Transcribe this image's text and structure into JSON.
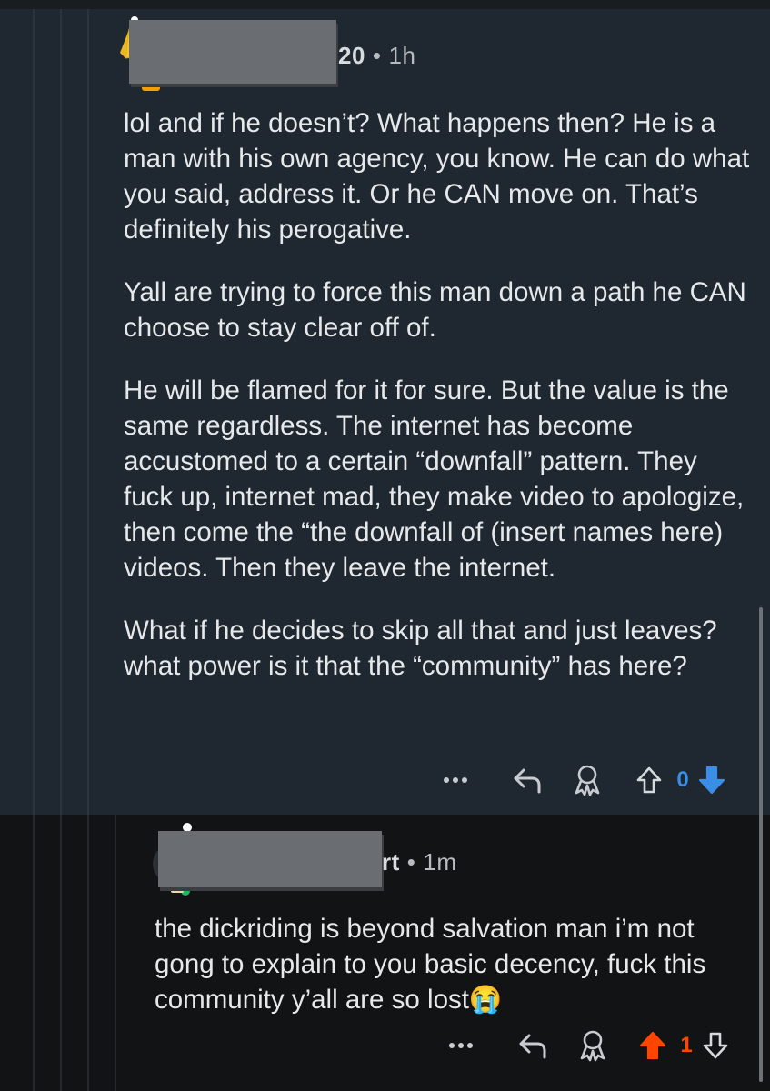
{
  "comment1": {
    "author_tail": "20",
    "time": "1h",
    "paragraphs": [
      "lol and if he doesn’t? What happens then? He is a man with his own agency, you know. He can do what you said, address it. Or he CAN move on. That’s definitely his perogative.",
      "Yall are trying to force this man down a path he CAN choose to stay clear off of.",
      "He will be flamed for it for sure. But the value is the same regardless. The internet has become accustomed to a certain “downfall” pattern. They fuck up, internet mad, they make video to apologize, then come the “the downfall of (insert names here) videos. Then they leave the internet.",
      "What if he decides to skip all that and just leaves? what power is it that the “community” has here?"
    ],
    "vote_count": "0",
    "upvote_color": "#d7dadc",
    "downvote_color": "#3b8ee6",
    "count_color": "#3b8ee6"
  },
  "comment2": {
    "author_tail": "rt",
    "time": "1m",
    "text": "the dickriding is beyond salvation man i’m not gong to explain to you basic decency, fuck this community y’all are so lost",
    "emoji": "😭",
    "vote_count": "1",
    "upvote_color": "#ff4500",
    "downvote_color": "#d7dadc",
    "count_color": "#ff4500"
  },
  "icons": {
    "more": "more-options-icon",
    "reply": "reply-icon",
    "award": "award-icon",
    "upvote": "upvote-arrow-icon",
    "downvote": "downvote-arrow-icon"
  }
}
